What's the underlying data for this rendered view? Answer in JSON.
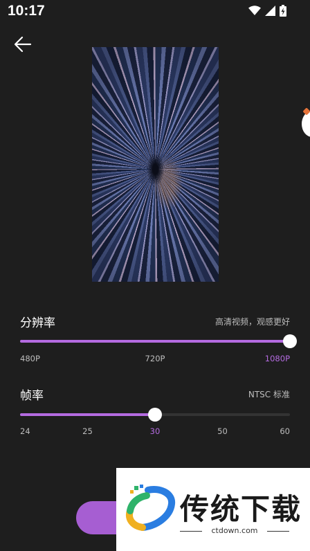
{
  "status": {
    "time": "10:17",
    "icons": [
      "wifi-icon",
      "signal-icon",
      "battery-icon"
    ]
  },
  "back_icon": "arrow-left-icon",
  "resolution": {
    "title": "分辨率",
    "hint": "高清视频，观感更好",
    "value_fraction": 1.0,
    "ticks": [
      {
        "label": "480P",
        "active": false
      },
      {
        "label": "720P",
        "active": false
      },
      {
        "label": "1080P",
        "active": true
      }
    ]
  },
  "framerate": {
    "title": "帧率",
    "hint": "NTSC 标准",
    "value_fraction": 0.5,
    "ticks": [
      {
        "label": "24",
        "active": false
      },
      {
        "label": "25",
        "active": false
      },
      {
        "label": "30",
        "active": true
      },
      {
        "label": "50",
        "active": false
      },
      {
        "label": "60",
        "active": false
      }
    ]
  },
  "watermark": {
    "title": "传统下载",
    "url": "ctdown.com"
  },
  "colors": {
    "accent": "#b46be0",
    "background": "#1e1e1e",
    "button": "#a65ed2"
  }
}
